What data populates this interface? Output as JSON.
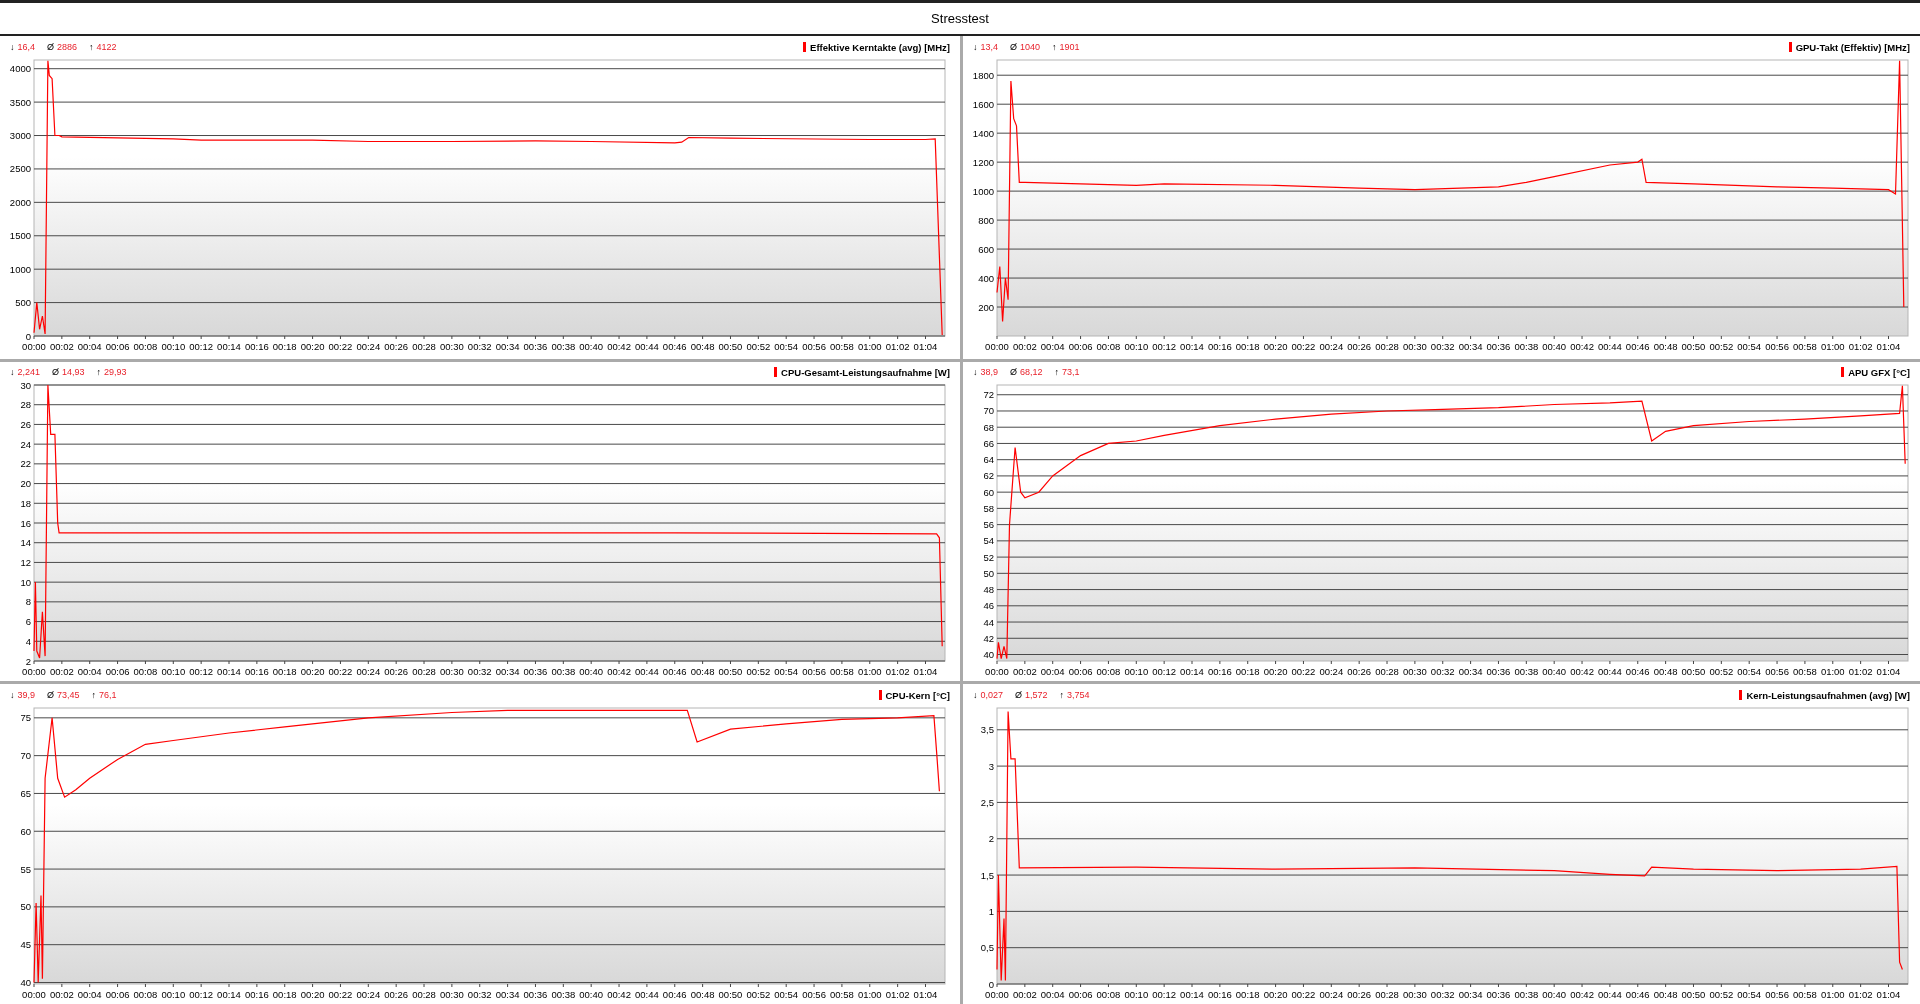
{
  "window": {
    "title": "Stresstest"
  },
  "panels": [
    {
      "stats": [
        {
          "symbol": "↓",
          "value": "16,4"
        },
        {
          "symbol": "Ø",
          "value": "2886"
        },
        {
          "symbol": "↑",
          "value": "4122"
        }
      ],
      "chart_data": {
        "type": "line",
        "title": "Effektive Kerntakte (avg) [MHz]",
        "x": [
          0,
          0.2,
          0.4,
          0.6,
          0.8,
          1.0,
          1.1,
          1.3,
          1.5,
          1.8,
          2,
          10,
          12,
          20,
          24,
          30,
          36,
          40,
          46,
          46.5,
          47,
          50,
          60,
          64,
          64.7,
          65.2
        ],
        "series": [
          {
            "color": "#ff0000",
            "values": [
              50,
              500,
              100,
              300,
              30,
              4120,
              3900,
              3850,
              3000,
              3000,
              2980,
              2950,
              2930,
              2930,
              2910,
              2910,
              2920,
              2910,
              2890,
              2900,
              2970,
              2960,
              2940,
              2940,
              2950,
              16.4
            ]
          }
        ],
        "grid": true,
        "xlim": [
          0,
          65.4
        ],
        "ylim": [
          0,
          4130
        ],
        "yticks": [
          0,
          500,
          1000,
          1500,
          2000,
          2500,
          3000,
          3500,
          4000
        ],
        "xticks": [
          {
            "value": 0,
            "label": "00:00"
          },
          {
            "value": 2,
            "label": "00:02"
          },
          {
            "value": 4,
            "label": "00:04"
          },
          {
            "value": 6,
            "label": "00:06"
          },
          {
            "value": 8,
            "label": "00:08"
          },
          {
            "value": 10,
            "label": "00:10"
          },
          {
            "value": 12,
            "label": "00:12"
          },
          {
            "value": 14,
            "label": "00:14"
          },
          {
            "value": 16,
            "label": "00:16"
          },
          {
            "value": 18,
            "label": "00:18"
          },
          {
            "value": 20,
            "label": "00:20"
          },
          {
            "value": 22,
            "label": "00:22"
          },
          {
            "value": 24,
            "label": "00:24"
          },
          {
            "value": 26,
            "label": "00:26"
          },
          {
            "value": 28,
            "label": "00:28"
          },
          {
            "value": 30,
            "label": "00:30"
          },
          {
            "value": 32,
            "label": "00:32"
          },
          {
            "value": 34,
            "label": "00:34"
          },
          {
            "value": 36,
            "label": "00:36"
          },
          {
            "value": 38,
            "label": "00:38"
          },
          {
            "value": 40,
            "label": "00:40"
          },
          {
            "value": 42,
            "label": "00:42"
          },
          {
            "value": 44,
            "label": "00:44"
          },
          {
            "value": 46,
            "label": "00:46"
          },
          {
            "value": 48,
            "label": "00:48"
          },
          {
            "value": 50,
            "label": "00:50"
          },
          {
            "value": 52,
            "label": "00:52"
          },
          {
            "value": 54,
            "label": "00:54"
          },
          {
            "value": 56,
            "label": "00:56"
          },
          {
            "value": 58,
            "label": "00:58"
          },
          {
            "value": 60,
            "label": "01:00"
          },
          {
            "value": 62,
            "label": "01:02"
          },
          {
            "value": 64,
            "label": "01:04"
          }
        ]
      }
    },
    {
      "stats": [
        {
          "symbol": "↓",
          "value": "13,4"
        },
        {
          "symbol": "Ø",
          "value": "1040"
        },
        {
          "symbol": "↑",
          "value": "1901"
        }
      ],
      "chart_data": {
        "type": "line",
        "title": "GPU-Takt (Effektiv) [MHz]",
        "x": [
          0,
          0.2,
          0.4,
          0.6,
          0.8,
          1.0,
          1.2,
          1.4,
          1.6,
          2,
          10,
          12,
          20,
          26,
          30,
          36,
          38,
          40,
          44,
          46,
          46.3,
          46.6,
          50,
          56,
          60,
          64,
          64.5,
          64.8,
          65.1
        ],
        "series": [
          {
            "color": "#ff0000",
            "values": [
              300,
              480,
              100,
              400,
              250,
              1760,
              1500,
              1450,
              1060,
              1060,
              1040,
              1050,
              1040,
              1020,
              1010,
              1030,
              1060,
              1100,
              1180,
              1200,
              1220,
              1060,
              1050,
              1030,
              1020,
              1010,
              980,
              1900,
              200
            ]
          }
        ],
        "grid": true,
        "xlim": [
          0,
          65.4
        ],
        "ylim": [
          0,
          1905
        ],
        "yticks": [
          200,
          400,
          600,
          800,
          1000,
          1200,
          1400,
          1600,
          1800
        ],
        "xticks": [
          {
            "value": 0,
            "label": "00:00"
          },
          {
            "value": 2,
            "label": "00:02"
          },
          {
            "value": 4,
            "label": "00:04"
          },
          {
            "value": 6,
            "label": "00:06"
          },
          {
            "value": 8,
            "label": "00:08"
          },
          {
            "value": 10,
            "label": "00:10"
          },
          {
            "value": 12,
            "label": "00:12"
          },
          {
            "value": 14,
            "label": "00:14"
          },
          {
            "value": 16,
            "label": "00:16"
          },
          {
            "value": 18,
            "label": "00:18"
          },
          {
            "value": 20,
            "label": "00:20"
          },
          {
            "value": 22,
            "label": "00:22"
          },
          {
            "value": 24,
            "label": "00:24"
          },
          {
            "value": 26,
            "label": "00:26"
          },
          {
            "value": 28,
            "label": "00:28"
          },
          {
            "value": 30,
            "label": "00:30"
          },
          {
            "value": 32,
            "label": "00:32"
          },
          {
            "value": 34,
            "label": "00:34"
          },
          {
            "value": 36,
            "label": "00:36"
          },
          {
            "value": 38,
            "label": "00:38"
          },
          {
            "value": 40,
            "label": "00:40"
          },
          {
            "value": 42,
            "label": "00:42"
          },
          {
            "value": 44,
            "label": "00:44"
          },
          {
            "value": 46,
            "label": "00:46"
          },
          {
            "value": 48,
            "label": "00:48"
          },
          {
            "value": 50,
            "label": "00:50"
          },
          {
            "value": 52,
            "label": "00:52"
          },
          {
            "value": 54,
            "label": "00:54"
          },
          {
            "value": 56,
            "label": "00:56"
          },
          {
            "value": 58,
            "label": "00:58"
          },
          {
            "value": 60,
            "label": "01:00"
          },
          {
            "value": 62,
            "label": "01:02"
          },
          {
            "value": 64,
            "label": "01:04"
          }
        ]
      }
    },
    {
      "stats": [
        {
          "symbol": "↓",
          "value": "2,241"
        },
        {
          "symbol": "Ø",
          "value": "14,93"
        },
        {
          "symbol": "↑",
          "value": "29,93"
        }
      ],
      "chart_data": {
        "type": "line",
        "title": "CPU-Gesamt-Leistungsaufnahme [W]",
        "x": [
          0,
          0.1,
          0.2,
          0.4,
          0.6,
          0.8,
          1.0,
          1.2,
          1.5,
          1.7,
          1.8,
          46,
          64.8,
          65,
          65.2
        ],
        "series": [
          {
            "color": "#ff0000",
            "values": [
              3,
              10,
              3,
              2.3,
              7,
              2.5,
              30,
              25,
              25,
              16,
              15,
              15,
              14.9,
              14.5,
              3.5
            ]
          }
        ],
        "grid": true,
        "xlim": [
          0,
          65.4
        ],
        "ylim": [
          2,
          30
        ],
        "yticks": [
          2,
          4,
          6,
          8,
          10,
          12,
          14,
          16,
          18,
          20,
          22,
          24,
          26,
          28,
          30
        ],
        "xticks": [
          {
            "value": 0,
            "label": "00:00"
          },
          {
            "value": 2,
            "label": "00:02"
          },
          {
            "value": 4,
            "label": "00:04"
          },
          {
            "value": 6,
            "label": "00:06"
          },
          {
            "value": 8,
            "label": "00:08"
          },
          {
            "value": 10,
            "label": "00:10"
          },
          {
            "value": 12,
            "label": "00:12"
          },
          {
            "value": 14,
            "label": "00:14"
          },
          {
            "value": 16,
            "label": "00:16"
          },
          {
            "value": 18,
            "label": "00:18"
          },
          {
            "value": 20,
            "label": "00:20"
          },
          {
            "value": 22,
            "label": "00:22"
          },
          {
            "value": 24,
            "label": "00:24"
          },
          {
            "value": 26,
            "label": "00:26"
          },
          {
            "value": 28,
            "label": "00:28"
          },
          {
            "value": 30,
            "label": "00:30"
          },
          {
            "value": 32,
            "label": "00:32"
          },
          {
            "value": 34,
            "label": "00:34"
          },
          {
            "value": 36,
            "label": "00:36"
          },
          {
            "value": 38,
            "label": "00:38"
          },
          {
            "value": 40,
            "label": "00:40"
          },
          {
            "value": 42,
            "label": "00:42"
          },
          {
            "value": 44,
            "label": "00:44"
          },
          {
            "value": 46,
            "label": "00:46"
          },
          {
            "value": 48,
            "label": "00:48"
          },
          {
            "value": 50,
            "label": "00:50"
          },
          {
            "value": 52,
            "label": "00:52"
          },
          {
            "value": 54,
            "label": "00:54"
          },
          {
            "value": 56,
            "label": "00:56"
          },
          {
            "value": 58,
            "label": "00:58"
          },
          {
            "value": 60,
            "label": "01:00"
          },
          {
            "value": 62,
            "label": "01:02"
          },
          {
            "value": 64,
            "label": "01:04"
          }
        ]
      }
    },
    {
      "stats": [
        {
          "symbol": "↓",
          "value": "38,9"
        },
        {
          "symbol": "Ø",
          "value": "68,12"
        },
        {
          "symbol": "↑",
          "value": "73,1"
        }
      ],
      "chart_data": {
        "type": "line",
        "title": "APU GFX [°C]",
        "x": [
          0,
          0.1,
          0.3,
          0.5,
          0.7,
          0.9,
          1.3,
          1.7,
          2,
          3,
          4,
          6,
          8,
          10,
          12,
          16,
          20,
          24,
          28,
          32,
          36,
          40,
          44,
          46.3,
          47,
          48,
          50,
          54,
          58,
          62,
          64.8,
          65,
          65.2
        ],
        "series": [
          {
            "color": "#ff0000",
            "values": [
              39.5,
              41.5,
              39.5,
              41,
              39.5,
              56,
              65.5,
              60,
              59.3,
              60,
              62,
              64.5,
              66,
              66.3,
              67,
              68.2,
              69,
              69.6,
              70,
              70.2,
              70.4,
              70.8,
              71,
              71.2,
              66.3,
              67.5,
              68.2,
              68.7,
              69,
              69.4,
              69.7,
              73.1,
              63.5
            ]
          }
        ],
        "grid": true,
        "xlim": [
          0,
          65.4
        ],
        "ylim": [
          39.2,
          73.2
        ],
        "yticks": [
          40,
          42,
          44,
          46,
          48,
          50,
          52,
          54,
          56,
          58,
          60,
          62,
          64,
          66,
          68,
          70,
          72
        ],
        "xticks": [
          {
            "value": 0,
            "label": "00:00"
          },
          {
            "value": 2,
            "label": "00:02"
          },
          {
            "value": 4,
            "label": "00:04"
          },
          {
            "value": 6,
            "label": "00:06"
          },
          {
            "value": 8,
            "label": "00:08"
          },
          {
            "value": 10,
            "label": "00:10"
          },
          {
            "value": 12,
            "label": "00:12"
          },
          {
            "value": 14,
            "label": "00:14"
          },
          {
            "value": 16,
            "label": "00:16"
          },
          {
            "value": 18,
            "label": "00:18"
          },
          {
            "value": 20,
            "label": "00:20"
          },
          {
            "value": 22,
            "label": "00:22"
          },
          {
            "value": 24,
            "label": "00:24"
          },
          {
            "value": 26,
            "label": "00:26"
          },
          {
            "value": 28,
            "label": "00:28"
          },
          {
            "value": 30,
            "label": "00:30"
          },
          {
            "value": 32,
            "label": "00:32"
          },
          {
            "value": 34,
            "label": "00:34"
          },
          {
            "value": 36,
            "label": "00:36"
          },
          {
            "value": 38,
            "label": "00:38"
          },
          {
            "value": 40,
            "label": "00:40"
          },
          {
            "value": 42,
            "label": "00:42"
          },
          {
            "value": 44,
            "label": "00:44"
          },
          {
            "value": 46,
            "label": "00:46"
          },
          {
            "value": 48,
            "label": "00:48"
          },
          {
            "value": 50,
            "label": "00:50"
          },
          {
            "value": 52,
            "label": "00:52"
          },
          {
            "value": 54,
            "label": "00:54"
          },
          {
            "value": 56,
            "label": "00:56"
          },
          {
            "value": 58,
            "label": "00:58"
          },
          {
            "value": 60,
            "label": "01:00"
          },
          {
            "value": 62,
            "label": "01:02"
          },
          {
            "value": 64,
            "label": "01:04"
          }
        ]
      }
    },
    {
      "stats": [
        {
          "symbol": "↓",
          "value": "39,9"
        },
        {
          "symbol": "Ø",
          "value": "73,45"
        },
        {
          "symbol": "↑",
          "value": "76,1"
        }
      ],
      "chart_data": {
        "type": "line",
        "title": "CPU-Kern [°C]",
        "x": [
          0,
          0.15,
          0.3,
          0.5,
          0.6,
          0.8,
          1.3,
          1.7,
          2.2,
          3,
          4,
          6,
          8,
          10,
          14,
          18,
          24,
          30,
          34,
          46.9,
          47.6,
          50,
          54,
          58,
          62,
          64.6,
          64.8,
          65
        ],
        "series": [
          {
            "color": "#ff0000",
            "values": [
              40,
              50.5,
              40,
              51.5,
              40.5,
              67,
              75,
              67,
              64.5,
              65.5,
              67,
              69.5,
              71.5,
              72,
              73,
              73.8,
              75,
              75.7,
              76,
              76,
              71.8,
              73.5,
              74.2,
              74.8,
              75,
              75.3,
              70.5,
              65.3
            ]
          }
        ],
        "grid": true,
        "xlim": [
          0,
          65.4
        ],
        "ylim": [
          39.8,
          76.3
        ],
        "yticks": [
          40,
          45,
          50,
          55,
          60,
          65,
          70,
          75
        ],
        "xticks": [
          {
            "value": 0,
            "label": "00:00"
          },
          {
            "value": 2,
            "label": "00:02"
          },
          {
            "value": 4,
            "label": "00:04"
          },
          {
            "value": 6,
            "label": "00:06"
          },
          {
            "value": 8,
            "label": "00:08"
          },
          {
            "value": 10,
            "label": "00:10"
          },
          {
            "value": 12,
            "label": "00:12"
          },
          {
            "value": 14,
            "label": "00:14"
          },
          {
            "value": 16,
            "label": "00:16"
          },
          {
            "value": 18,
            "label": "00:18"
          },
          {
            "value": 20,
            "label": "00:20"
          },
          {
            "value": 22,
            "label": "00:22"
          },
          {
            "value": 24,
            "label": "00:24"
          },
          {
            "value": 26,
            "label": "00:26"
          },
          {
            "value": 28,
            "label": "00:28"
          },
          {
            "value": 30,
            "label": "00:30"
          },
          {
            "value": 32,
            "label": "00:32"
          },
          {
            "value": 34,
            "label": "00:34"
          },
          {
            "value": 36,
            "label": "00:36"
          },
          {
            "value": 38,
            "label": "00:38"
          },
          {
            "value": 40,
            "label": "00:40"
          },
          {
            "value": 42,
            "label": "00:42"
          },
          {
            "value": 44,
            "label": "00:44"
          },
          {
            "value": 46,
            "label": "00:46"
          },
          {
            "value": 48,
            "label": "00:48"
          },
          {
            "value": 50,
            "label": "00:50"
          },
          {
            "value": 52,
            "label": "00:52"
          },
          {
            "value": 54,
            "label": "00:54"
          },
          {
            "value": 56,
            "label": "00:56"
          },
          {
            "value": 58,
            "label": "00:58"
          },
          {
            "value": 60,
            "label": "01:00"
          },
          {
            "value": 62,
            "label": "01:02"
          },
          {
            "value": 64,
            "label": "01:04"
          }
        ]
      }
    },
    {
      "stats": [
        {
          "symbol": "↓",
          "value": "0,027"
        },
        {
          "symbol": "Ø",
          "value": "1,572"
        },
        {
          "symbol": "↑",
          "value": "3,754"
        }
      ],
      "chart_data": {
        "type": "line",
        "title": "Kern-Leistungsaufnahmen (avg) [W]",
        "x": [
          0,
          0.1,
          0.3,
          0.5,
          0.6,
          0.8,
          1.0,
          1.3,
          1.6,
          10,
          20,
          30,
          40,
          44,
          46.5,
          47,
          50,
          56,
          62,
          64.6,
          64.8,
          65
        ],
        "series": [
          {
            "color": "#ff0000",
            "values": [
              0.2,
              1.5,
              0.05,
              0.9,
              0.05,
              3.75,
              3.1,
              3.1,
              1.6,
              1.61,
              1.58,
              1.6,
              1.56,
              1.51,
              1.49,
              1.61,
              1.58,
              1.56,
              1.58,
              1.62,
              0.3,
              0.2
            ]
          }
        ],
        "grid": true,
        "xlim": [
          0,
          65.4
        ],
        "ylim": [
          0,
          3.8
        ],
        "yticks": [
          {
            "value": 0,
            "label": "0"
          },
          {
            "value": 0.5,
            "label": "0,5"
          },
          {
            "value": 1,
            "label": "1"
          },
          {
            "value": 1.5,
            "label": "1,5"
          },
          {
            "value": 2,
            "label": "2"
          },
          {
            "value": 2.5,
            "label": "2,5"
          },
          {
            "value": 3,
            "label": "3"
          },
          {
            "value": 3.5,
            "label": "3,5"
          }
        ],
        "xticks": [
          {
            "value": 0,
            "label": "00:00"
          },
          {
            "value": 2,
            "label": "00:02"
          },
          {
            "value": 4,
            "label": "00:04"
          },
          {
            "value": 6,
            "label": "00:06"
          },
          {
            "value": 8,
            "label": "00:08"
          },
          {
            "value": 10,
            "label": "00:10"
          },
          {
            "value": 12,
            "label": "00:12"
          },
          {
            "value": 14,
            "label": "00:14"
          },
          {
            "value": 16,
            "label": "00:16"
          },
          {
            "value": 18,
            "label": "00:18"
          },
          {
            "value": 20,
            "label": "00:20"
          },
          {
            "value": 22,
            "label": "00:22"
          },
          {
            "value": 24,
            "label": "00:24"
          },
          {
            "value": 26,
            "label": "00:26"
          },
          {
            "value": 28,
            "label": "00:28"
          },
          {
            "value": 30,
            "label": "00:30"
          },
          {
            "value": 32,
            "label": "00:32"
          },
          {
            "value": 34,
            "label": "00:34"
          },
          {
            "value": 36,
            "label": "00:36"
          },
          {
            "value": 38,
            "label": "00:38"
          },
          {
            "value": 40,
            "label": "00:40"
          },
          {
            "value": 42,
            "label": "00:42"
          },
          {
            "value": 44,
            "label": "00:44"
          },
          {
            "value": 46,
            "label": "00:46"
          },
          {
            "value": 48,
            "label": "00:48"
          },
          {
            "value": 50,
            "label": "00:50"
          },
          {
            "value": 52,
            "label": "00:52"
          },
          {
            "value": 54,
            "label": "00:54"
          },
          {
            "value": 56,
            "label": "00:56"
          },
          {
            "value": 58,
            "label": "00:58"
          },
          {
            "value": 60,
            "label": "01:00"
          },
          {
            "value": 62,
            "label": "01:02"
          },
          {
            "value": 64,
            "label": "01:04"
          }
        ]
      }
    }
  ]
}
